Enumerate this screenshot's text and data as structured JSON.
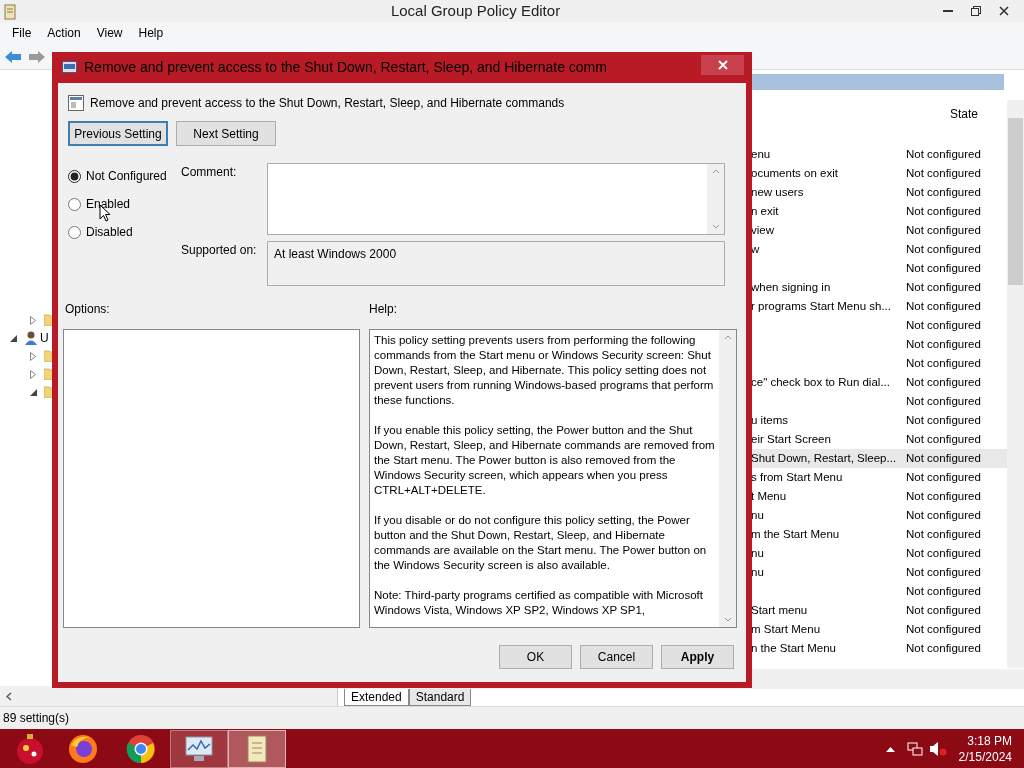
{
  "window": {
    "title": "Local Group Policy Editor"
  },
  "menu": [
    "File",
    "Action",
    "View",
    "Help"
  ],
  "tree": [
    {
      "children": [
        {
          "kind": "folder",
          "expanded": false
        }
      ]
    },
    {
      "kind": "user",
      "label": "U",
      "expanded": true,
      "children": [
        {
          "kind": "folder",
          "expanded": false
        },
        {
          "kind": "folder",
          "expanded": false
        },
        {
          "kind": "folder",
          "expanded": true
        }
      ]
    }
  ],
  "list": {
    "columns": [
      "State"
    ],
    "rows": [
      {
        "name": "enu",
        "state": "Not configured",
        "selected": false
      },
      {
        "name": "ocuments on exit",
        "state": "Not configured",
        "selected": false
      },
      {
        "name": "new users",
        "state": "Not configured",
        "selected": false
      },
      {
        "name": "n exit",
        "state": "Not configured",
        "selected": false
      },
      {
        "name": "view",
        "state": "Not configured",
        "selected": false
      },
      {
        "name": "w",
        "state": "Not configured",
        "selected": false
      },
      {
        "state": "Not configured",
        "selected": false
      },
      {
        "name": "when signing in",
        "state": "Not configured",
        "selected": false
      },
      {
        "name": "r programs Start Menu sh...",
        "state": "Not configured",
        "selected": false
      },
      {
        "state": "Not configured",
        "selected": false
      },
      {
        "state": "Not configured",
        "selected": false
      },
      {
        "state": "Not configured",
        "selected": false
      },
      {
        "name": "ce\" check box to Run dial...",
        "state": "Not configured",
        "selected": false
      },
      {
        "state": "Not configured",
        "selected": false
      },
      {
        "name": "u items",
        "state": "Not configured",
        "selected": false
      },
      {
        "name": "eir Start Screen",
        "state": "Not configured",
        "selected": false
      },
      {
        "name": "Shut Down, Restart, Sleep...",
        "state": "Not configured",
        "selected": true
      },
      {
        "name": "s from Start Menu",
        "state": "Not configured",
        "selected": false
      },
      {
        "name": "t Menu",
        "state": "Not configured",
        "selected": false
      },
      {
        "name": "nu",
        "state": "Not configured",
        "selected": false
      },
      {
        "name": "m the Start Menu",
        "state": "Not configured",
        "selected": false
      },
      {
        "name": "nu",
        "state": "Not configured",
        "selected": false
      },
      {
        "name": "nu",
        "state": "Not configured",
        "selected": false
      },
      {
        "state": "Not configured",
        "selected": false
      },
      {
        "name": "Start menu",
        "state": "Not configured",
        "selected": false
      },
      {
        "name": "m Start Menu",
        "state": "Not configured",
        "selected": false
      },
      {
        "name": "n the Start Menu",
        "state": "Not configured",
        "selected": false
      }
    ]
  },
  "view_tabs": [
    {
      "label": "Extended",
      "selected": true
    },
    {
      "label": "Standard",
      "selected": false
    }
  ],
  "status_bar": "89 setting(s)",
  "dialog": {
    "title": "Remove and prevent access to the Shut Down, Restart, Sleep, and Hibernate comm",
    "heading": "Remove and prevent access to the Shut Down, Restart, Sleep, and Hibernate commands",
    "nav_buttons": [
      {
        "label": "Previous Setting",
        "focused": true
      },
      {
        "label": "Next Setting",
        "focused": false
      }
    ],
    "options": [
      {
        "label": "Not Configured",
        "selected": true
      },
      {
        "label": "Enabled",
        "selected": false
      },
      {
        "label": "Disabled",
        "selected": false
      }
    ],
    "comment_label": "Comment:",
    "supported_label": "Supported on:",
    "supported_value": "At least Windows 2000",
    "options_label": "Options:",
    "help_label": "Help:",
    "help": [
      "This policy setting prevents users from performing the following commands from the Start menu or Windows Security screen: Shut Down, Restart, Sleep, and Hibernate. This policy setting does not prevent users from running Windows-based programs that perform these functions.",
      "If you enable this policy setting, the Power button and the Shut Down, Restart, Sleep, and Hibernate commands are removed from the Start menu. The Power button is also removed from the Windows Security screen, which appears when you press CTRL+ALT+DELETE.",
      "If you disable or do not configure this policy setting, the Power button and the Shut Down, Restart, Sleep, and Hibernate commands are available on the Start menu. The Power button on the Windows Security screen is also available.",
      "Note: Third-party programs certified as compatible with Microsoft Windows Vista, Windows XP SP2, Windows XP SP1,"
    ],
    "buttons": [
      {
        "label": "OK",
        "bold": false
      },
      {
        "label": "Cancel",
        "bold": false
      },
      {
        "label": "Apply",
        "bold": true
      }
    ]
  },
  "taskbar": {
    "apps": [
      {
        "kind": "firefox",
        "selected": false
      },
      {
        "kind": "chrome",
        "selected": false
      },
      {
        "kind": "monitor",
        "selected": false
      },
      {
        "kind": "scroll",
        "selected": true
      }
    ],
    "time": "3:18 PM",
    "date": "2/15/2024"
  }
}
